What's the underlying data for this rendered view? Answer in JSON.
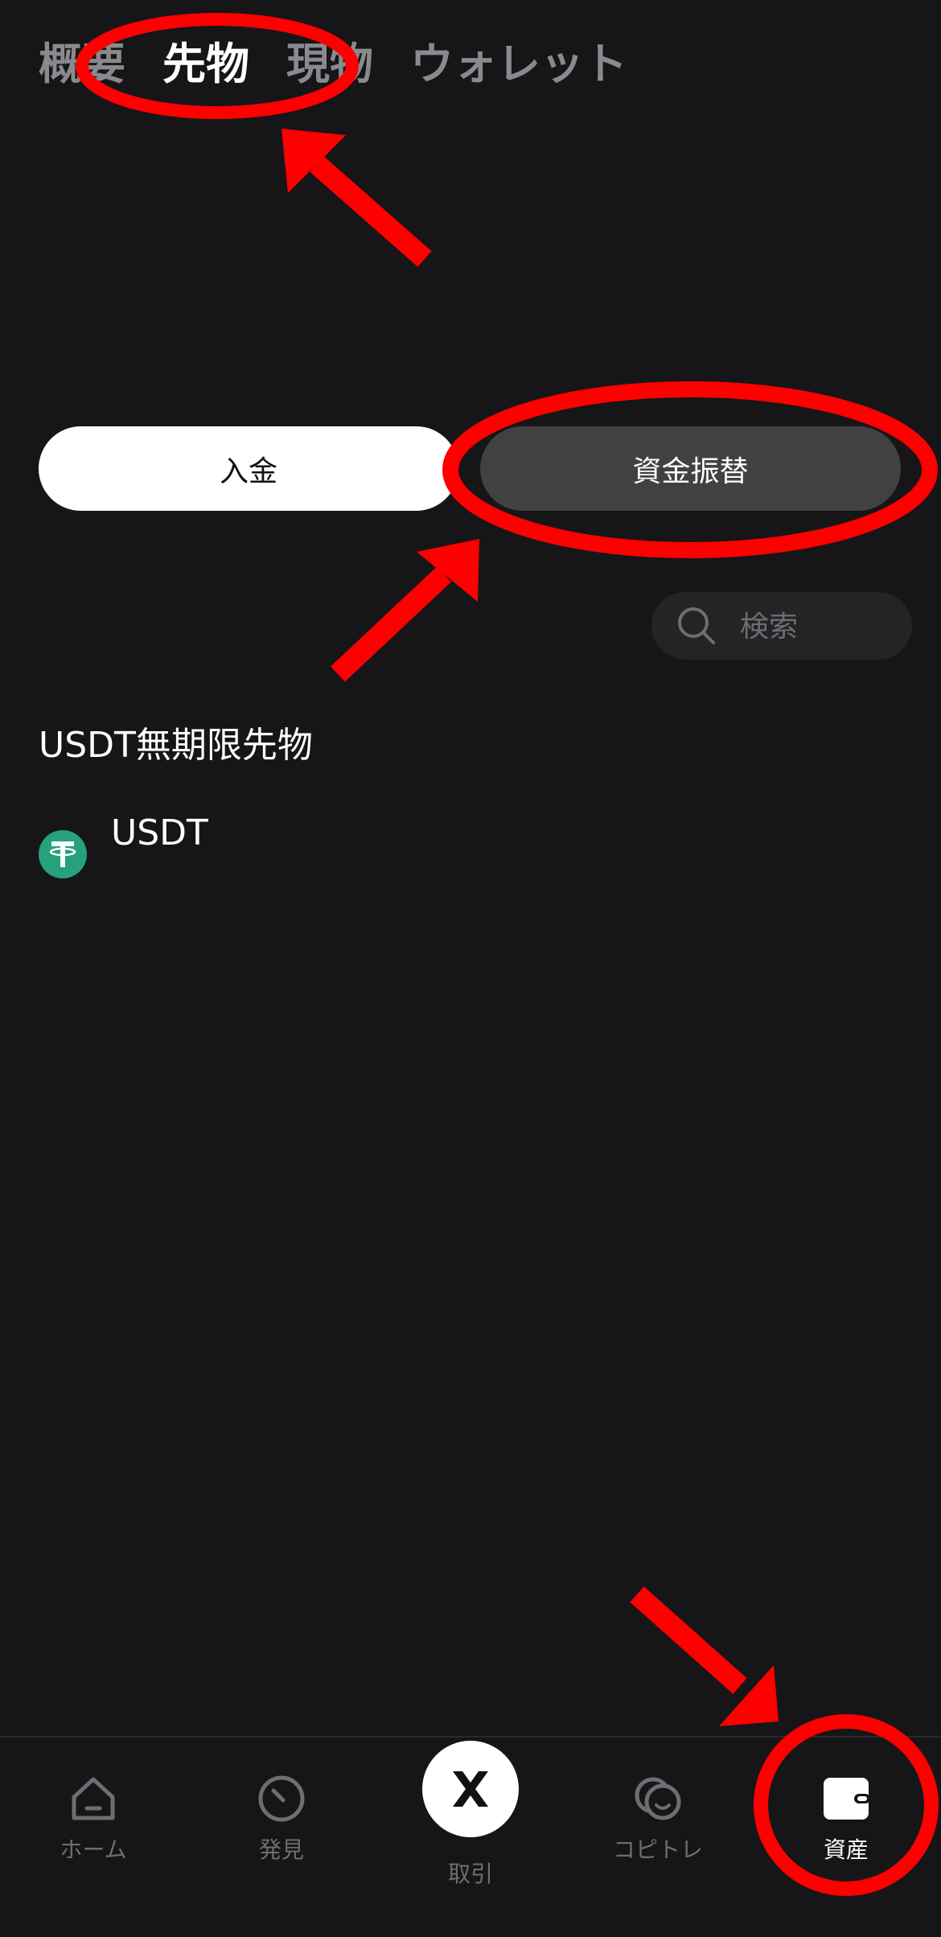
{
  "top_tabs": [
    {
      "label": "概要",
      "active": false
    },
    {
      "label": "先物",
      "active": true
    },
    {
      "label": "現物",
      "active": false
    },
    {
      "label": "ウォレット",
      "active": false
    }
  ],
  "actions": {
    "deposit_label": "入金",
    "transfer_label": "資金振替"
  },
  "search": {
    "placeholder": "検索"
  },
  "section": {
    "title": "USDT無期限先物"
  },
  "assets": [
    {
      "name": "USDT",
      "icon": "tether-icon",
      "icon_color": "#26a17b"
    }
  ],
  "bottom_nav": [
    {
      "label": "ホーム",
      "icon": "home-icon",
      "active": false
    },
    {
      "label": "発見",
      "icon": "compass-icon",
      "active": false
    },
    {
      "label": "取引",
      "icon": "trade-icon",
      "active": false
    },
    {
      "label": "コピトレ",
      "icon": "copy-trade-icon",
      "active": false
    },
    {
      "label": "資産",
      "icon": "wallet-icon",
      "active": true
    }
  ],
  "colors": {
    "background": "#161618",
    "annotation": "#ff0000",
    "secondary_button": "#414143",
    "inactive_text": "#8a8a8e"
  }
}
